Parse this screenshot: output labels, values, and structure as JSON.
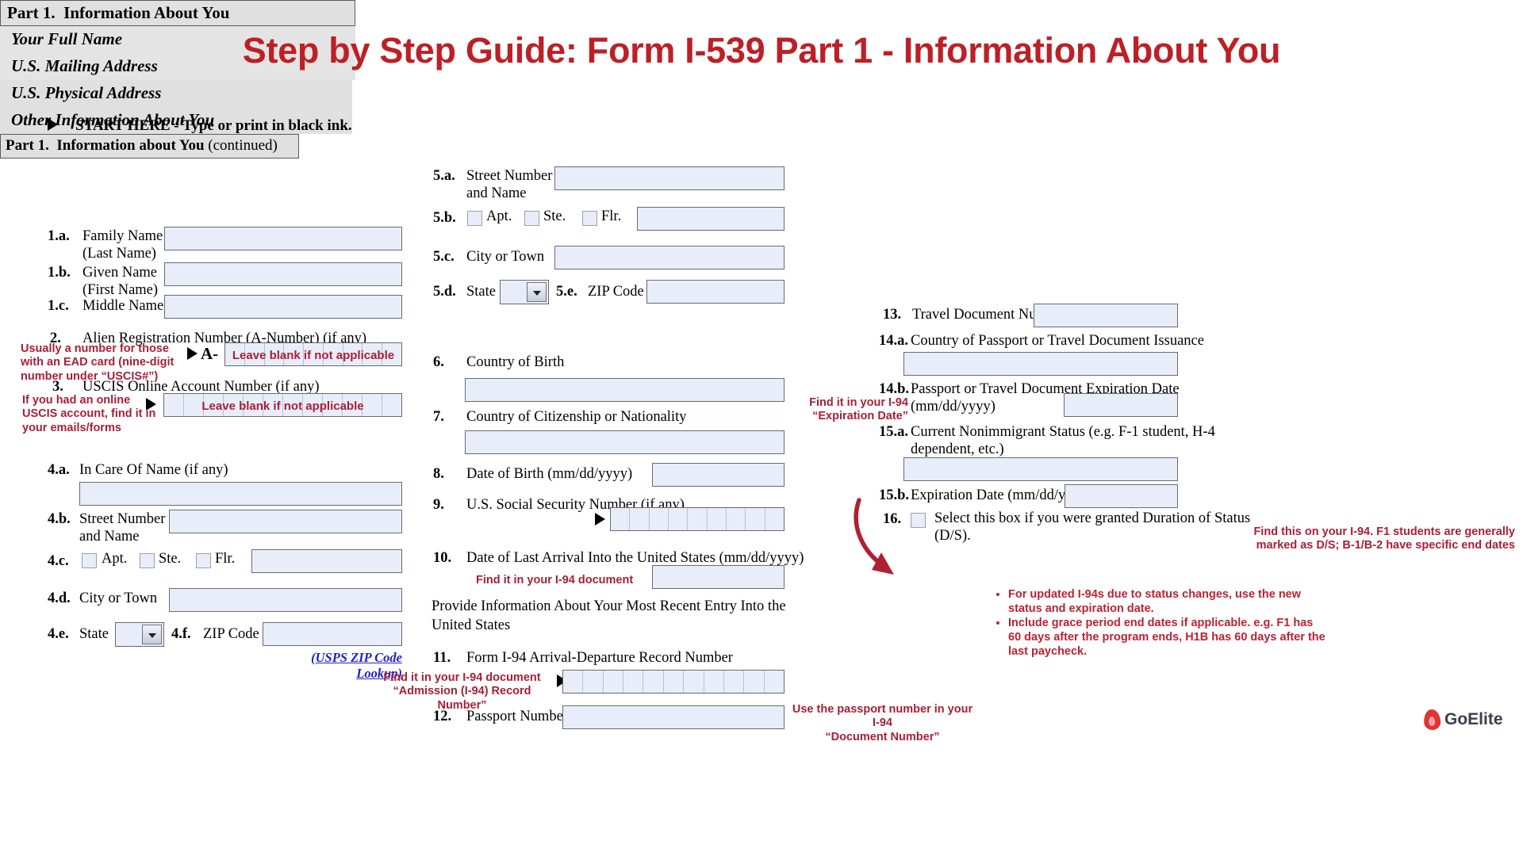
{
  "title": "Step by Step Guide: Form I-539 Part 1 - Information About You",
  "start_here": "START HERE - Type or print in black ink.",
  "colors": {
    "title_red": "#bc2026",
    "annotation_red": "#a81f35",
    "link_blue": "#2020cc",
    "field_fill": "#e9edfa",
    "bar_fill": "#e0e0e0"
  },
  "left_column": {
    "part_header": {
      "part": "Part 1.",
      "title": "Information About You"
    },
    "section_full_name": "Your Full Name",
    "items": [
      {
        "num": "1.a.",
        "label_line1": "Family Name",
        "label_line2": "(Last Name)"
      },
      {
        "num": "1.b.",
        "label_line1": "Given Name",
        "label_line2": "(First Name)"
      },
      {
        "num": "1.c.",
        "label_line1": "Middle Name",
        "label_line2": ""
      },
      {
        "num": "2.",
        "label_line1": "Alien Registration Number (A-Number) (if any)",
        "label_line2": ""
      },
      {
        "num": "3.",
        "label_line1": "USCIS Online Account Number (if any)",
        "label_line2": ""
      }
    ],
    "a_prefix": "A-",
    "section_mailing_address": "U.S. Mailing Address",
    "mailing_items": [
      {
        "num": "4.a.",
        "label": "In Care Of Name (if any)"
      },
      {
        "num": "4.b.",
        "label_line1": "Street Number",
        "label_line2": "and Name"
      },
      {
        "num": "4.c.",
        "label": ""
      },
      {
        "num": "4.d.",
        "label": "City or Town"
      },
      {
        "num": "4.e.",
        "label": "State"
      },
      {
        "num": "4.f.",
        "label": "ZIP Code"
      }
    ],
    "checkbox_labels": {
      "apt": "Apt.",
      "ste": "Ste.",
      "flr": "Flr."
    },
    "usps_link": "(USPS ZIP Code Lookup)",
    "annotations": {
      "a_number_note": "Usually a number for those with an EAD card (nine-digit number under “USCIS#”)",
      "a_number_inline": "Leave blank if not applicable",
      "uscis_account_note": "If you had an online USCIS account, find it in your emails/forms",
      "uscis_account_inline": "Leave blank if not applicable"
    }
  },
  "middle_column": {
    "section_physical_address": "U.S. Physical Address",
    "physical_items": [
      {
        "num": "5.a.",
        "label_line1": "Street Number",
        "label_line2": "and Name"
      },
      {
        "num": "5.b.",
        "label": ""
      },
      {
        "num": "5.c.",
        "label": "City or Town"
      },
      {
        "num": "5.d.",
        "label": "State"
      },
      {
        "num": "5.e.",
        "label": "ZIP Code"
      }
    ],
    "checkbox_labels": {
      "apt": "Apt.",
      "ste": "Ste.",
      "flr": "Flr."
    },
    "section_other_info": "Other Information About You",
    "other_items": [
      {
        "num": "6.",
        "label": "Country of Birth"
      },
      {
        "num": "7.",
        "label": "Country of Citizenship or Nationality"
      },
      {
        "num": "8.",
        "label": "Date of Birth (mm/dd/yyyy)"
      },
      {
        "num": "9.",
        "label": "U.S. Social Security Number (if any)"
      },
      {
        "num": "10.",
        "label": "Date of Last Arrival Into the United States (mm/dd/yyyy)"
      }
    ],
    "recent_entry_heading": "Provide Information About Your Most Recent Entry Into the United States",
    "entry_items": [
      {
        "num": "11.",
        "label": "Form I-94 Arrival-Departure Record Number"
      },
      {
        "num": "12.",
        "label": "Passport Number"
      }
    ],
    "annotations": {
      "arrival_note": "Find it in your I-94 document",
      "i94_note_line1": "Find it in your I-94 document",
      "i94_note_line2": "“Admission (I-94) Record Number”"
    }
  },
  "right_column": {
    "part_header": {
      "part": "Part 1.",
      "title": "Information about You",
      "continued": "(continued)"
    },
    "items": [
      {
        "num": "13.",
        "label": "Travel Document Number"
      },
      {
        "num": "14.a.",
        "label": "Country of Passport or Travel Document Issuance"
      },
      {
        "num": "14.b.",
        "label_line1": "Passport or Travel Document Expiration Date",
        "label_line2": "(mm/dd/yyyy)"
      },
      {
        "num": "15.a.",
        "label_line1": "Current Nonimmigrant Status (e.g. F-1 student, H-4",
        "label_line2": "dependent, etc.)"
      },
      {
        "num": "15.b.",
        "label": "Expiration Date (mm/dd/yyyy)"
      },
      {
        "num": "16.",
        "label_line1": "Select this box if you were granted Duration of Status",
        "label_line2": "(D/S)."
      }
    ],
    "annotations": {
      "expiration_note_line1": "Find it in your I-94",
      "expiration_note_line2": "“Expiration Date”",
      "ds_note_line1": "Find this on your I-94. F1 students are generally",
      "ds_note_line2": "marked as D/S; B-1/B-2 have specific end dates",
      "bullets": [
        "For updated I-94s due to status changes, use the new status and expiration date.",
        "Include grace period end dates if applicable. e.g. F1 has 60 days after the program ends, H1B has 60 days after the last paycheck."
      ],
      "passport_note_line1": "Use the passport number in your I-94",
      "passport_note_line2": "“Document Number”"
    }
  },
  "footer": {
    "brand": "GoElite"
  }
}
